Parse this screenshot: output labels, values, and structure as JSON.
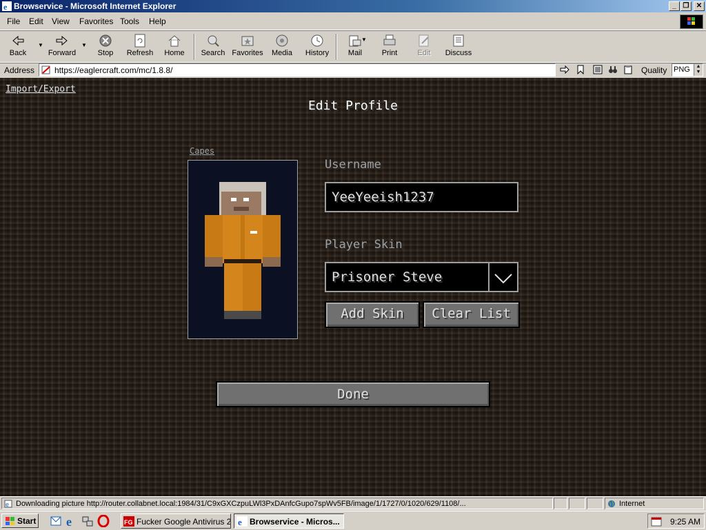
{
  "window": {
    "title": "Browservice - Microsoft Internet Explorer",
    "controls": {
      "minimize": "_",
      "restore": "❐",
      "close": "✕"
    }
  },
  "menu": {
    "items": [
      "File",
      "Edit",
      "View",
      "Favorites",
      "Tools",
      "Help"
    ]
  },
  "toolbar": {
    "buttons": [
      {
        "label": "Back",
        "icon": "back-arrow-icon"
      },
      {
        "label": "Forward",
        "icon": "forward-arrow-icon"
      },
      {
        "label": "Stop",
        "icon": "stop-icon"
      },
      {
        "label": "Refresh",
        "icon": "refresh-icon"
      },
      {
        "label": "Home",
        "icon": "home-icon"
      },
      {
        "label": "Search",
        "icon": "search-icon"
      },
      {
        "label": "Favorites",
        "icon": "favorites-icon"
      },
      {
        "label": "Media",
        "icon": "media-icon"
      },
      {
        "label": "History",
        "icon": "history-icon"
      },
      {
        "label": "Mail",
        "icon": "mail-icon"
      },
      {
        "label": "Print",
        "icon": "print-icon"
      },
      {
        "label": "Edit",
        "icon": "edit-icon",
        "disabled": true
      },
      {
        "label": "Discuss",
        "icon": "discuss-icon"
      }
    ]
  },
  "address": {
    "label": "Address",
    "url": "https://eaglercraft.com/mc/1.8.8/",
    "quality_label": "Quality",
    "quality_value": "PNG"
  },
  "game": {
    "import_export": "Import/Export",
    "title": "Edit Profile",
    "capes": "Capes",
    "username_label": "Username",
    "username_value": "YeeYeeish1237",
    "skin_label": "Player Skin",
    "skin_value": "Prisoner Steve",
    "add_skin": "Add Skin",
    "clear_list": "Clear List",
    "done": "Done"
  },
  "status": {
    "text": "Downloading picture http://router.collabnet.local:1984/31/C9xGXCzpuLWl3PxDAnfcGupo7spWv5FB/image/1/1727/0/1020/629/1108/...",
    "zone": "Internet"
  },
  "taskbar": {
    "start": "Start",
    "tasks": [
      {
        "label": "Fucker Google Antivirus 2...",
        "active": false
      },
      {
        "label": "Browservice - Micros...",
        "active": true
      }
    ],
    "clock": "9:25 AM"
  },
  "colors": {
    "title_bar": "#0a246a",
    "chrome": "#d4d0c8",
    "game_bg": "#2b2119",
    "skin_orange": "#d4861c"
  }
}
